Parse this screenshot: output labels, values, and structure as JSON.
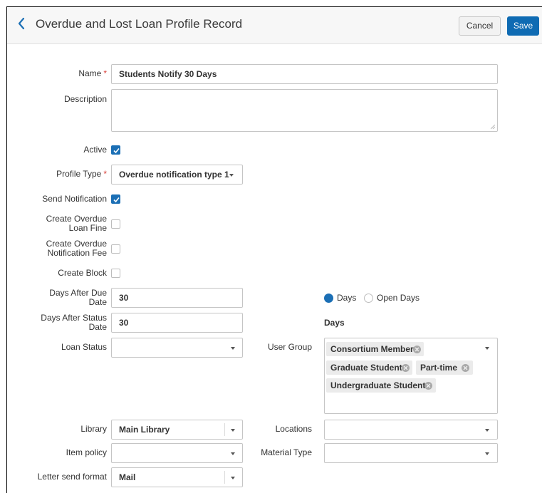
{
  "header": {
    "title": "Overdue and Lost Loan Profile Record",
    "cancel_label": "Cancel",
    "save_label": "Save"
  },
  "form": {
    "name_label": "Name",
    "required_mark": "*",
    "name_value": "Students Notify 30 Days",
    "description_label": "Description",
    "description_value": "",
    "active_label": "Active",
    "active_checked": true,
    "profile_type_label": "Profile Type",
    "profile_type_value": "Overdue notification type 1",
    "send_notification_label": "Send Notification",
    "send_notification_checked": true,
    "create_overdue_loan_fine_label_1": "Create Overdue",
    "create_overdue_loan_fine_label_2": "Loan Fine",
    "create_overdue_loan_fine_checked": false,
    "create_overdue_notification_fee_label_1": "Create Overdue",
    "create_overdue_notification_fee_label_2": "Notification Fee",
    "create_overdue_notification_fee_checked": false,
    "create_block_label": "Create Block",
    "create_block_checked": false,
    "days_after_due_date_label_1": "Days After Due",
    "days_after_due_date_label_2": "Date",
    "days_after_due_date_value": "30",
    "days_after_status_date_label_1": "Days After Status",
    "days_after_status_date_label_2": "Date",
    "days_after_status_date_value": "30",
    "day_type_options": [
      "Days",
      "Open Days"
    ],
    "day_type_selected": "Days",
    "days_heading": "Days",
    "loan_status_label": "Loan Status",
    "loan_status_value": "",
    "user_group_label": "User Group",
    "user_group_values": [
      "Consortium Member",
      "Graduate Student",
      "Part-time",
      "Undergraduate Student"
    ],
    "library_label": "Library",
    "library_value": "Main Library",
    "locations_label": "Locations",
    "locations_value": "",
    "item_policy_label": "Item policy",
    "item_policy_value": "",
    "material_type_label": "Material Type",
    "material_type_value": "",
    "letter_send_format_label": "Letter send format",
    "letter_send_format_value": "Mail"
  },
  "colors": {
    "primary": "#0f6bb3",
    "required": "#d9413b",
    "header_bg": "#f7f7f7"
  }
}
